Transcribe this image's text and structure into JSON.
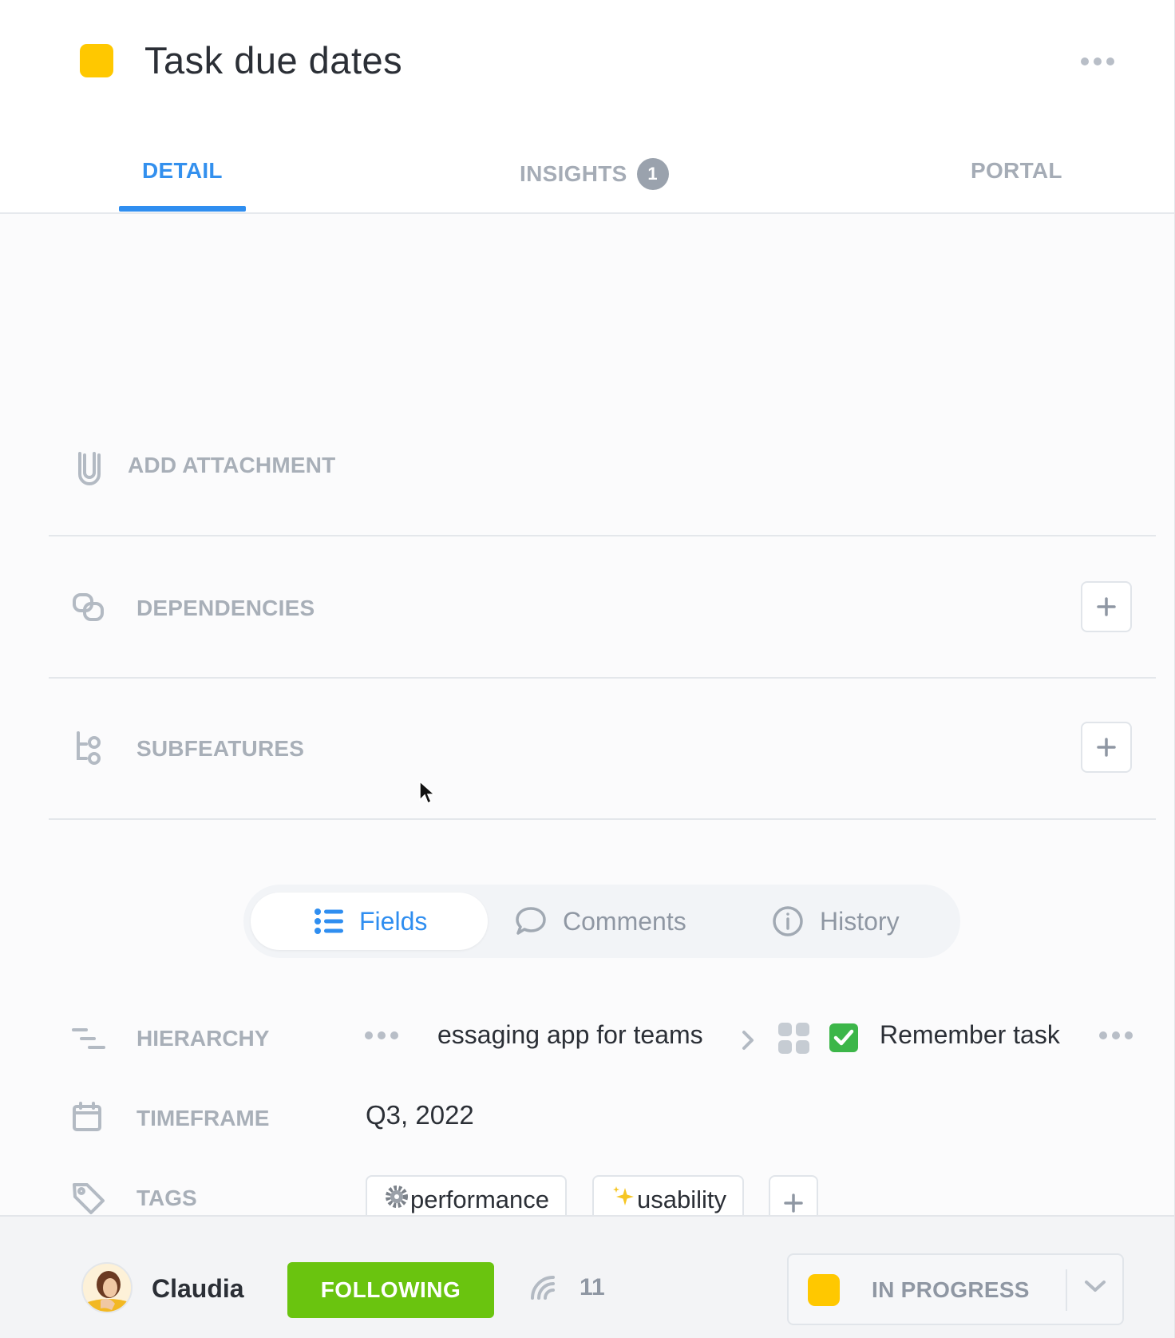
{
  "header": {
    "title": "Task due dates",
    "status_color": "#ffc800",
    "menu_icon": "more-horizontal-icon"
  },
  "tabs": [
    {
      "label": "DETAIL",
      "active": true
    },
    {
      "label": "INSIGHTS",
      "badge": "1",
      "active": false
    },
    {
      "label": "PORTAL",
      "active": false
    }
  ],
  "sections": {
    "attachment": {
      "label": "ADD ATTACHMENT",
      "icon": "paperclip-icon"
    },
    "dependencies": {
      "label": "DEPENDENCIES",
      "icon": "link-icon"
    },
    "subfeatures": {
      "label": "SUBFEATURES",
      "icon": "subfeature-tree-icon"
    }
  },
  "segmented": [
    {
      "label": "Fields",
      "icon": "list-icon",
      "active": true
    },
    {
      "label": "Comments",
      "icon": "comment-icon",
      "active": false
    },
    {
      "label": "History",
      "icon": "info-icon",
      "active": false
    }
  ],
  "fields": {
    "hierarchy": {
      "label": "HIERARCHY",
      "parent": "essaging app for teams",
      "current": "Remember task",
      "current_emoji": "✅"
    },
    "timeframe": {
      "label": "TIMEFRAME",
      "value": "Q3, 2022"
    },
    "tags": {
      "label": "TAGS",
      "items": [
        {
          "emoji": "⚙️",
          "text": "performance"
        },
        {
          "emoji": "✨",
          "text": "usability"
        }
      ]
    }
  },
  "footer": {
    "user_name": "Claudia",
    "follow_label": "FOLLOWING",
    "follow_color": "#6ac40f",
    "followers_count": "11",
    "status_label": "IN PROGRESS",
    "status_color": "#ffc800"
  }
}
